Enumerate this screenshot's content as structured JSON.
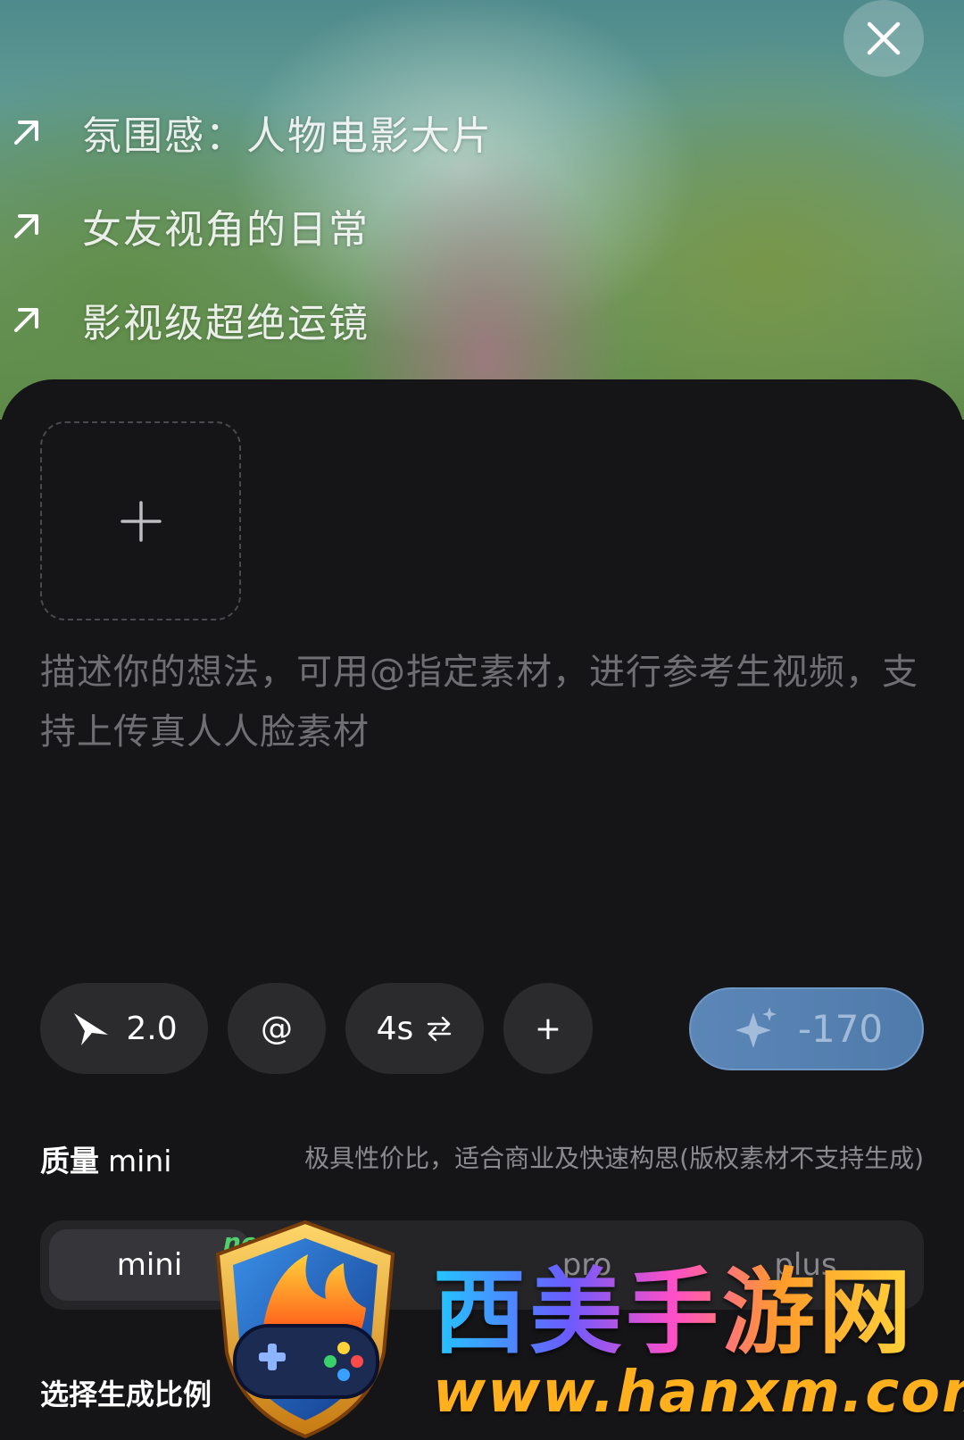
{
  "suggestions": [
    {
      "label": "氛围感：人物电影大片"
    },
    {
      "label": "女友视角的日常"
    },
    {
      "label": "影视级超绝运镜"
    }
  ],
  "prompt": {
    "placeholder": "描述你的想法，可用@指定素材，进行参考生视频，支持上传真人人脸素材"
  },
  "toolbar": {
    "model_version": "2.0",
    "mention_label": "@",
    "duration_label": "4s",
    "add_label": "+",
    "generate_cost": "-170"
  },
  "quality": {
    "title": "质量",
    "mode": "mini",
    "description": "极具性价比，适合商业及快速构思(版权素材不支持生成)"
  },
  "quality_tabs": [
    {
      "label": "mini",
      "badge": "new",
      "active": true
    },
    {
      "label": "+",
      "active": false
    },
    {
      "label": "pro",
      "active": false
    },
    {
      "label": "plus",
      "active": false
    }
  ],
  "ratio": {
    "title": "选择生成比例"
  },
  "watermark": {
    "title": "西美手游网",
    "url": "www.hanxm.com"
  },
  "colors": {
    "panel_bg": "#151517",
    "pill_bg": "#2b2b2e",
    "generate_button": "#5b86b7",
    "new_badge": "#4fd06a"
  }
}
